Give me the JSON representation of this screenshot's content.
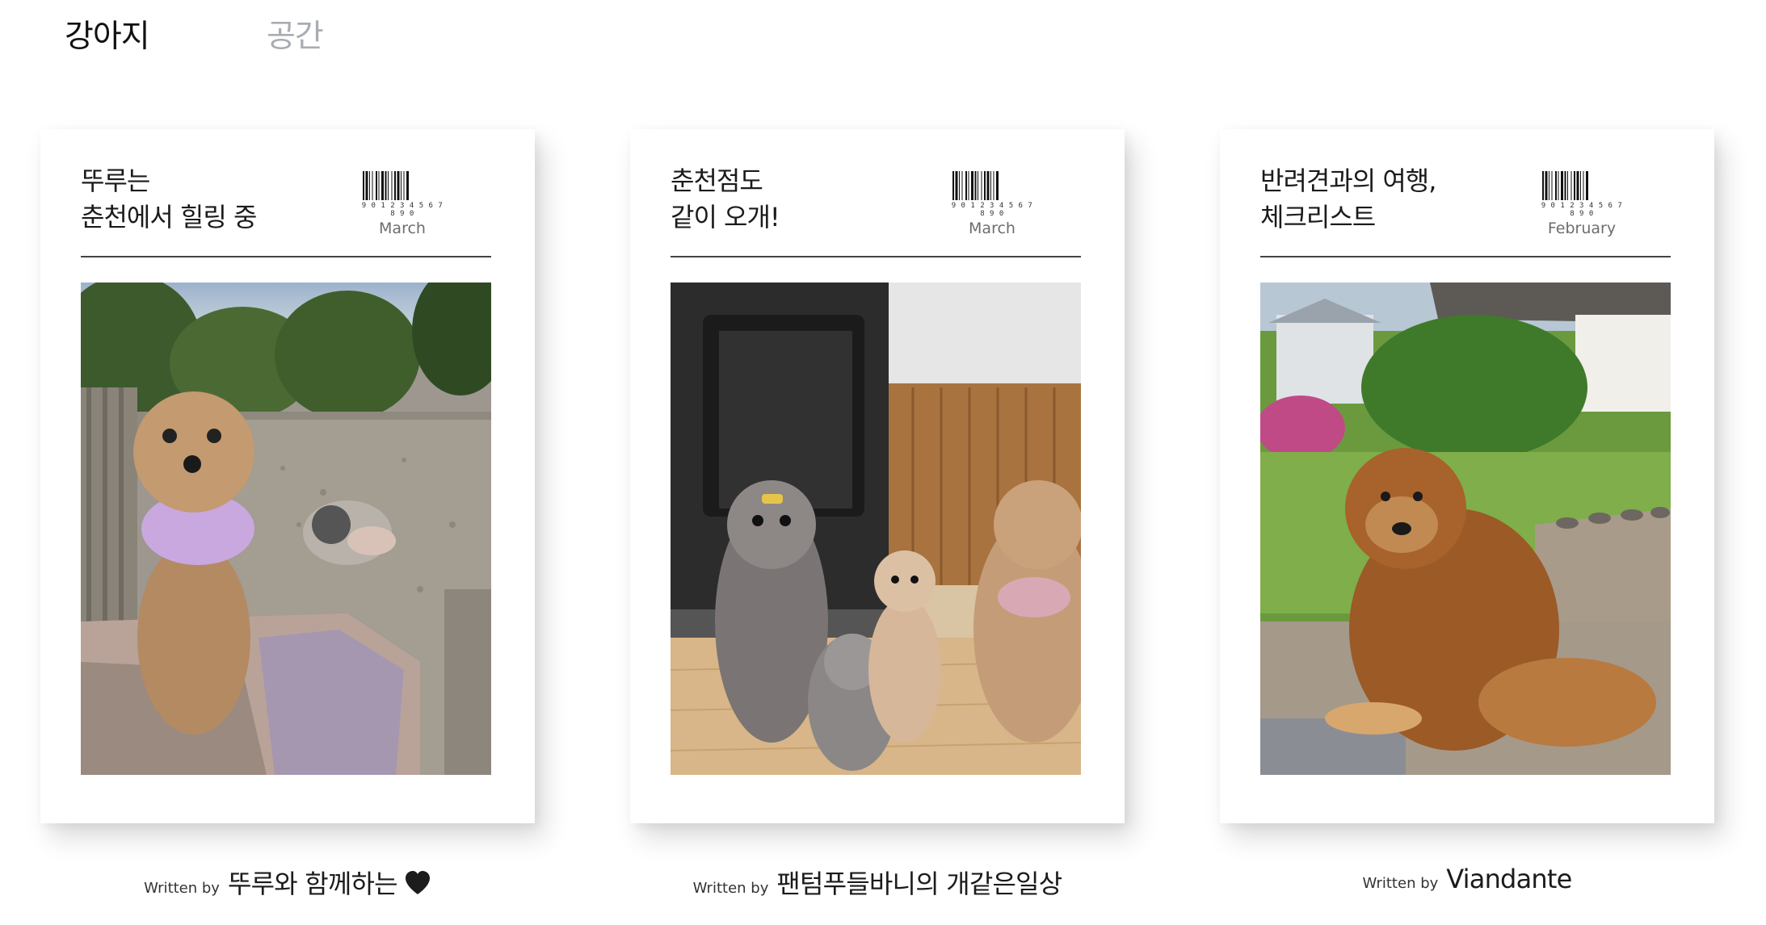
{
  "tabs": [
    {
      "label": "강아지",
      "active": true
    },
    {
      "label": "공간",
      "active": false
    }
  ],
  "cards": [
    {
      "title_lines": [
        "뚜루는",
        "춘천에서 힐링 중"
      ],
      "barcode_digits": "9 0 1 2 3 4 5 6 7 8 9 0",
      "month": "March",
      "written_by": "Written by",
      "author": "뚜루와 함께하는",
      "author_icon": "black-heart-icon",
      "photo": "poodle-on-bench-photo"
    },
    {
      "title_lines": [
        "춘천점도",
        "같이 오개!"
      ],
      "barcode_digits": "9 0 1 2 3 4 5 6 7 8 9 0",
      "month": "March",
      "written_by": "Written by",
      "author": "팬텀푸들바니의 개같은일상",
      "photo": "four-poodles-by-stove-photo"
    },
    {
      "title_lines": [
        "반려견과의 여행,",
        "체크리스트"
      ],
      "barcode_digits": "9 0 1 2 3 4 5 6 7 8 9 0",
      "month": "February",
      "written_by": "Written by",
      "author": "Viandante",
      "photo": "dog-in-garden-photo"
    }
  ],
  "colors": {
    "tab_active": "#111111",
    "tab_inactive": "#a9adb2",
    "rule": "#444444",
    "month_text": "#6d6d6d"
  }
}
